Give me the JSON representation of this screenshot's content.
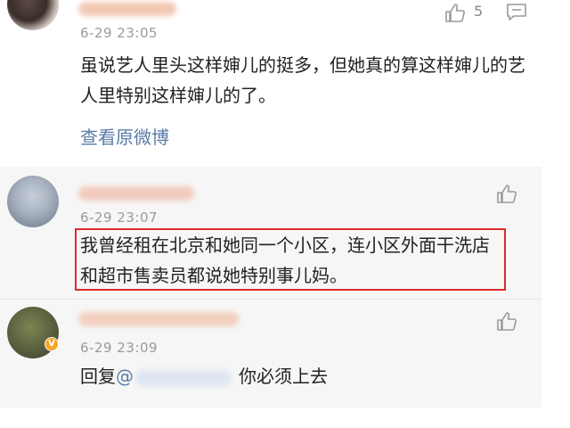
{
  "comments": [
    {
      "time": "6-29 23:05",
      "text": "虽说艺人里头这样婶儿的挺多，但她真的算这样婶儿的艺人里特别这样婶儿的了。",
      "link": "查看原微博",
      "likes": "5"
    },
    {
      "time": "6-29 23:07",
      "text": "我曾经租在北京和她同一个小区，连小区外面干洗店和超市售卖员都说她特别事儿妈。"
    },
    {
      "time": "6-29 23:09",
      "reply_prefix": "回复",
      "mention_at": "@",
      "reply_text": "你必须上去",
      "verified_badge": "V"
    }
  ],
  "colors": {
    "highlight": "#e02a2a",
    "link": "#5b7ca8",
    "badge": "#f5a623"
  },
  "icons": [
    "thumbs-up-icon",
    "reply-icon"
  ]
}
